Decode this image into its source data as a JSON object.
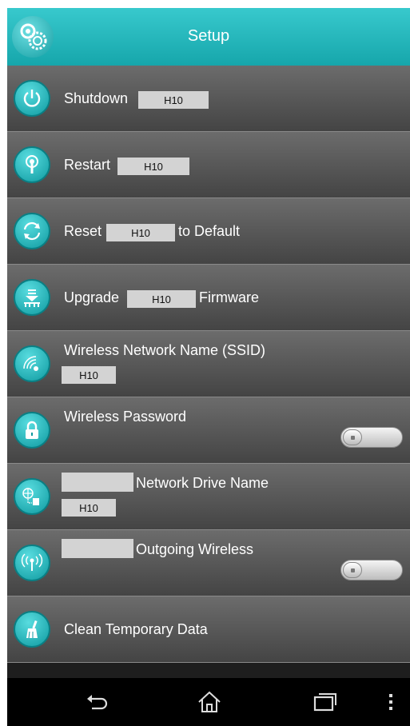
{
  "header": {
    "title": "Setup",
    "icon": "gears-icon"
  },
  "rows": [
    {
      "label": "Shutdown",
      "device": "H10",
      "icon": "power-icon"
    },
    {
      "label": "Restart",
      "device": "H10",
      "icon": "antenna-icon"
    },
    {
      "label": "Reset",
      "device": "H10",
      "suffix": "to Default",
      "icon": "refresh-icon"
    },
    {
      "label": "Upgrade",
      "device": "H10",
      "suffix": "Firmware",
      "icon": "upgrade-icon"
    },
    {
      "label": "Wireless Network Name (SSID)",
      "value": "H10",
      "icon": "wifi-icon"
    },
    {
      "label": "Wireless Password",
      "icon": "lock-icon",
      "toggle": "off"
    },
    {
      "label": "Network Drive Name",
      "value": "H10",
      "icon": "network-drive-icon"
    },
    {
      "label": "Outgoing Wireless",
      "icon": "broadcast-icon",
      "toggle": "off"
    },
    {
      "label": "Clean Temporary Data",
      "icon": "broom-icon"
    }
  ],
  "navbar": {
    "icons": [
      "back-icon",
      "home-icon",
      "recent-apps-icon",
      "menu-icon"
    ]
  },
  "colors": {
    "accent": "#16a6ab",
    "row_bg": "#555555",
    "chip": "#d3d3d3"
  }
}
